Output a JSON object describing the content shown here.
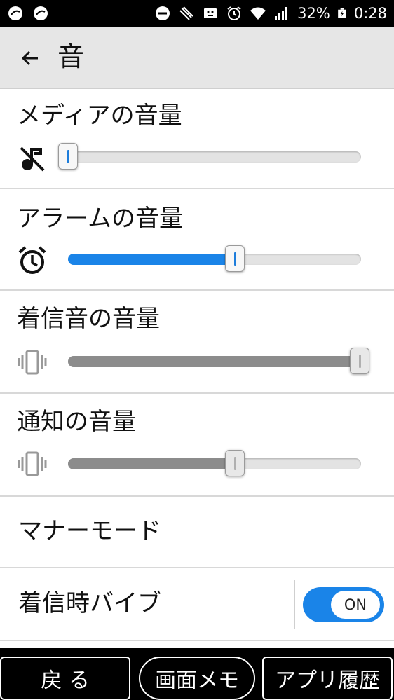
{
  "status_bar": {
    "battery_percent": "32%",
    "time": "0:28",
    "icons": [
      "app-notification-icon",
      "app-notification-icon",
      "do-not-disturb-icon",
      "nfc-icon",
      "sim-card-icon",
      "alarm-icon",
      "wifi-icon",
      "signal-icon",
      "battery-charging-icon"
    ]
  },
  "header": {
    "title": "音",
    "back_icon": "arrow-left-icon"
  },
  "volume_rows": [
    {
      "label": "メディアの音量",
      "icon": "music-muted-icon",
      "level": 0.0,
      "active": true
    },
    {
      "label": "アラームの音量",
      "icon": "alarm-clock-icon",
      "level": 0.57,
      "active": true
    },
    {
      "label": "着信音の音量",
      "icon": "vibrate-icon",
      "level": 1.0,
      "active": false
    },
    {
      "label": "通知の音量",
      "icon": "vibrate-icon",
      "level": 0.57,
      "active": false
    }
  ],
  "manner_mode": {
    "label": "マナーモード"
  },
  "vibrate_on_ring": {
    "label": "着信時バイブ",
    "toggle_text": "ON",
    "on": true
  },
  "nav": {
    "back_label": "戻 る",
    "memo_label": "画面メモ",
    "history_label": "アプリ履歴"
  },
  "colors": {
    "accent": "#1a84e8",
    "disabled_fill": "#8c8c8c",
    "appbar_bg": "#e6e6e6",
    "statusbar_bg": "#000000"
  }
}
